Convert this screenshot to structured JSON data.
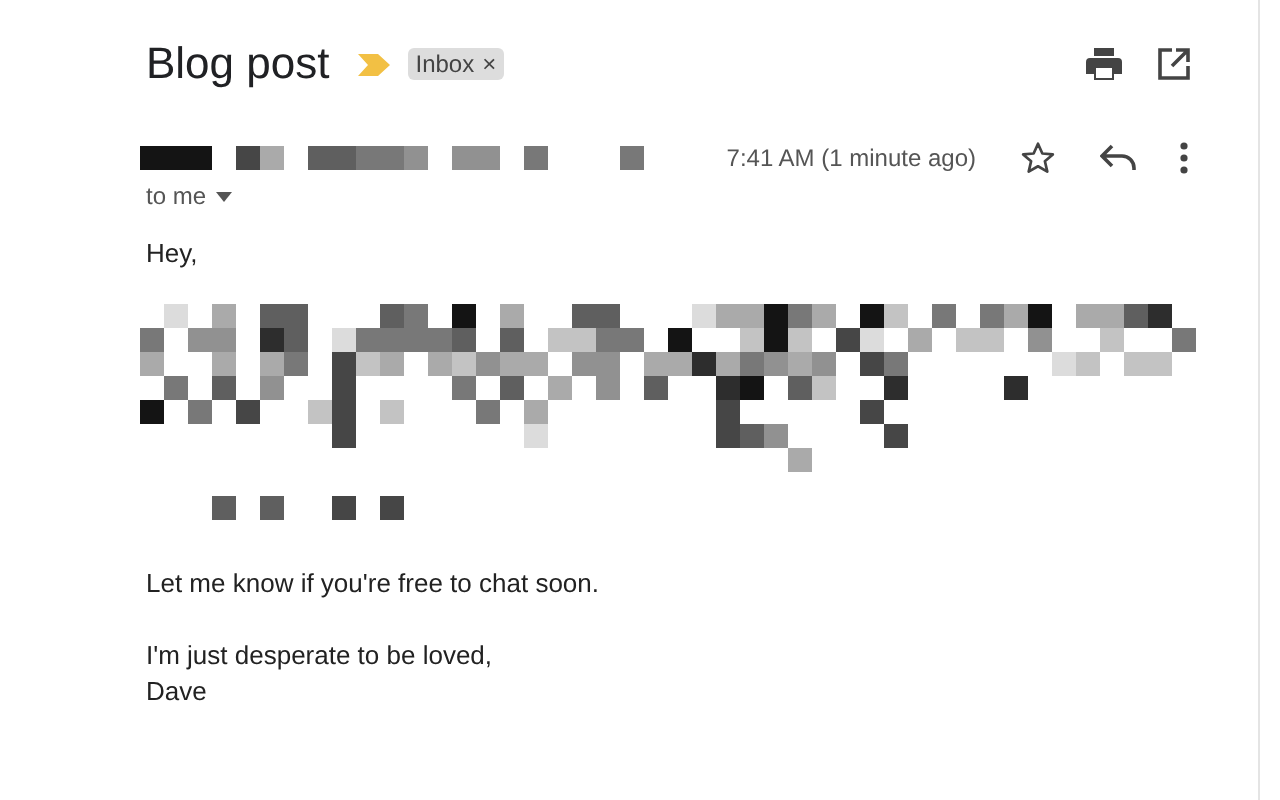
{
  "subject": "Blog post",
  "label": {
    "text": "Inbox",
    "remove": "×"
  },
  "message": {
    "time": "7:41 AM (1 minute ago)",
    "recipient": "to me",
    "greeting": "Hey,",
    "paragraphs": [
      "Let me know if you're free to chat soon."
    ],
    "closing": [
      "I'm just desperate to be loved,",
      "Dave"
    ]
  }
}
